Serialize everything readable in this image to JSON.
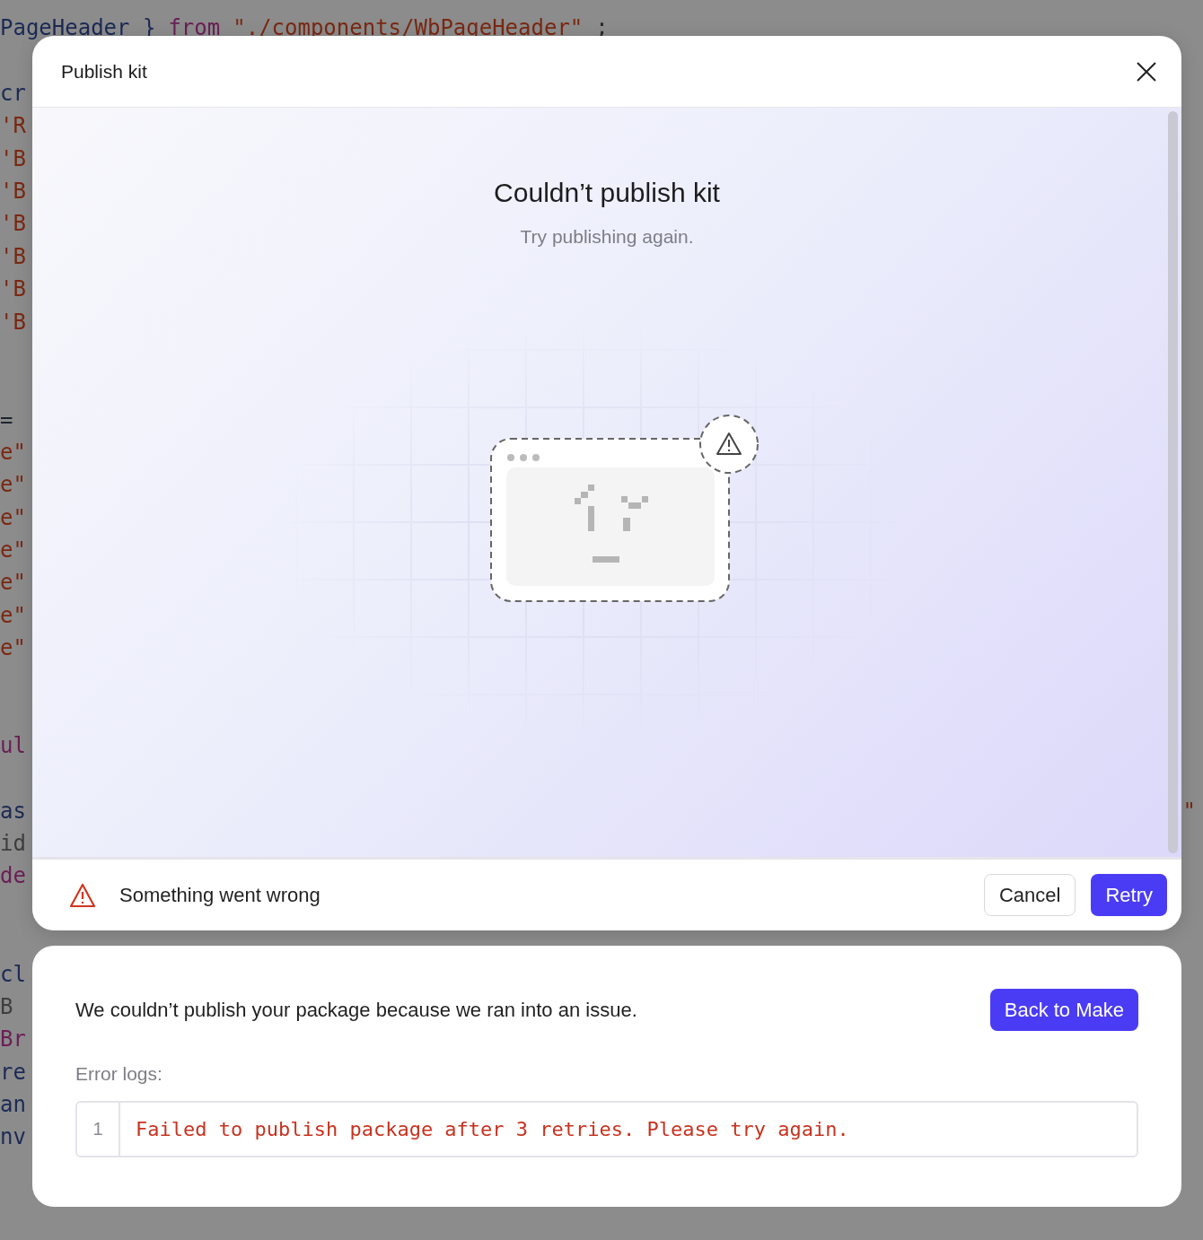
{
  "background_code": [
    {
      "segments": [
        {
          "text": "PageHeader }",
          "color": "#1b2a55"
        },
        {
          "text": "from",
          "color": "#6a1f55"
        },
        {
          "text": "\"./components/WbPageHeader\"",
          "color": "#7a2812"
        },
        {
          "text": ";",
          "color": "#2a2a2a"
        }
      ]
    },
    {
      "segments": [
        {
          "text": "cr",
          "color": "#1b2a55"
        }
      ]
    },
    {
      "segments": [
        {
          "text": "'R",
          "color": "#7a2812"
        }
      ]
    },
    {
      "segments": [
        {
          "text": "'B",
          "color": "#7a2812"
        }
      ]
    },
    {
      "segments": [
        {
          "text": "'B",
          "color": "#7a2812"
        }
      ]
    },
    {
      "segments": [
        {
          "text": "'B",
          "color": "#7a2812"
        }
      ]
    },
    {
      "segments": [
        {
          "text": "'B",
          "color": "#7a2812"
        }
      ]
    },
    {
      "segments": [
        {
          "text": "'B",
          "color": "#7a2812"
        }
      ]
    },
    {
      "segments": [
        {
          "text": "'B",
          "color": "#7a2812"
        }
      ]
    },
    {
      "segments": [
        {
          "text": "=",
          "color": "#1e2330"
        }
      ]
    },
    {
      "segments": [
        {
          "text": "e\"",
          "color": "#7a2812"
        }
      ]
    },
    {
      "segments": [
        {
          "text": "e\"",
          "color": "#7a2812"
        }
      ]
    },
    {
      "segments": [
        {
          "text": "e\"",
          "color": "#7a2812"
        }
      ]
    },
    {
      "segments": [
        {
          "text": "e\"",
          "color": "#7a2812"
        }
      ]
    },
    {
      "segments": [
        {
          "text": "e\"",
          "color": "#7a2812"
        }
      ]
    },
    {
      "segments": [
        {
          "text": "e\"",
          "color": "#7a2812"
        }
      ]
    },
    {
      "segments": [
        {
          "text": "e\"",
          "color": "#7a2812"
        }
      ]
    },
    {
      "segments": [
        {
          "text": "ul",
          "color": "#6a1f55"
        }
      ]
    },
    {
      "segments": [
        {
          "text": "as",
          "color": "#1b2a55"
        }
      ],
      "right": "\""
    },
    {
      "segments": [
        {
          "text": "id",
          "color": "#3e3e3e"
        }
      ]
    },
    {
      "segments": [
        {
          "text": "de",
          "color": "#6a1f55"
        }
      ]
    },
    {
      "segments": [
        {
          "text": "cl",
          "color": "#1b2a55"
        }
      ]
    },
    {
      "segments": [
        {
          "text": "B",
          "color": "#3e3e3e"
        }
      ]
    },
    {
      "segments": [
        {
          "text": "Br",
          "color": "#6a1f55"
        }
      ]
    },
    {
      "segments": [
        {
          "text": "re",
          "color": "#1b2a55"
        }
      ]
    },
    {
      "segments": [
        {
          "text": "an",
          "color": "#1b2a55"
        }
      ]
    },
    {
      "segments": [
        {
          "text": "nv",
          "color": "#1b2a55"
        }
      ]
    }
  ],
  "dialog": {
    "title": "Publish kit",
    "heading": "Couldn’t publish kit",
    "subtitle": "Try publishing again.",
    "status": "Something went wrong",
    "buttons": [
      {
        "label": "Cancel",
        "kind": "secondary"
      },
      {
        "label": "Retry",
        "kind": "primary"
      }
    ]
  },
  "details": {
    "message": "We couldn’t publish your package because we ran into an issue.",
    "button": "Back to Make",
    "logs_label": "Error logs:",
    "logs": [
      {
        "line": "1",
        "text": "Failed to publish package after 3 retries. Please try again."
      }
    ]
  }
}
